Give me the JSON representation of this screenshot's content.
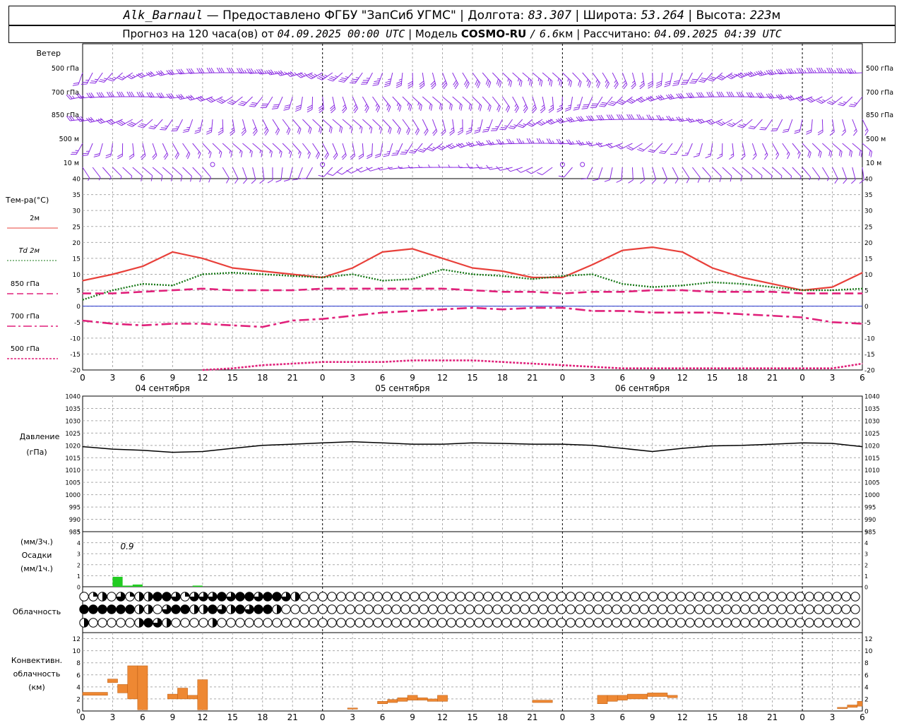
{
  "header": {
    "station": "Alk_Barnaul",
    "dash": "—",
    "provider": "Предоставлено ФГБУ \"ЗапСиб УГМС\"",
    "sep": "|",
    "lon_label": "Долгота:",
    "lon_value": "83.307",
    "lat_label": "Широта:",
    "lat_value": "53.264",
    "alt_label": "Высота:",
    "alt_value": "223",
    "alt_unit": "м",
    "forecast_text": "Прогноз на 120 часа(ов) от",
    "forecast_start": "04.09.2025 00:00 UTC",
    "model_label": "Модель",
    "model_name": "COSMO-RU",
    "model_res_sep": "/",
    "model_res": "6.6",
    "model_res_unit": "км",
    "calc_label": "Рассчитано:",
    "calc_time": "04.09.2025 04:39 UTC"
  },
  "colors": {
    "wind": "#8a2be2",
    "t2m": "#e8403a",
    "td2m": "#1a7a1a",
    "t850": "#e0207a",
    "t700": "#e0207a",
    "t500": "#e0207a",
    "pressure": "#000000",
    "precip": "#22cc22",
    "convective": "#ee8833",
    "zero_line": "#2233cc"
  },
  "wind_panel": {
    "title": "Ветер",
    "levels": [
      "500 гПа",
      "700 гПа",
      "850 гПа",
      "500 м",
      "10  м"
    ]
  },
  "temp_panel": {
    "title": "Тем-ра(°C)",
    "legend": [
      {
        "label": "2м",
        "style": "solid"
      },
      {
        "label": "Td  2м",
        "style": "dotted"
      },
      {
        "label": "850 гПа",
        "style": "dashed"
      },
      {
        "label": "700 гПа",
        "style": "dashdot"
      },
      {
        "label": "500 гПа",
        "style": "finedash"
      }
    ],
    "yticks": [
      "40",
      "35",
      "30",
      "25",
      "20",
      "15",
      "10",
      "5",
      "0",
      "-5",
      "-10",
      "-15",
      "-20"
    ]
  },
  "time_axis": {
    "hour_labels": [
      "0",
      "3",
      "6",
      "9",
      "12",
      "15",
      "18",
      "21",
      "0",
      "3",
      "6",
      "9",
      "12",
      "15",
      "18",
      "21",
      "0",
      "3",
      "6",
      "9",
      "12",
      "15",
      "18",
      "21",
      "0",
      "3",
      "6"
    ],
    "dates": [
      "04 сентября",
      "05 сентября",
      "06 сентября"
    ]
  },
  "pressure_panel": {
    "title": "Давление",
    "unit": "(гПа)",
    "yticks": [
      "1040",
      "1035",
      "1030",
      "1025",
      "1020",
      "1015",
      "1010",
      "1005",
      "1000",
      "995",
      "990",
      "985"
    ]
  },
  "precip_panel": {
    "unit_top": "(мм/3ч.)",
    "title": "Осадки",
    "unit_bottom": "(мм/1ч.)",
    "annotation": "0.9",
    "yticks": [
      "5",
      "4",
      "3",
      "2",
      "1",
      "0"
    ]
  },
  "cloud_panel": {
    "title": "Облачность",
    "rows": [
      "0120312244313334344344320000000000000000000000000000000000000000000000000000000000000000000000000000000000",
      "4444442203442243243442000000000000000000000000000000000000000000000000000000000000000000000000000000000000",
      "2000002432000020000000000000000000000000000000000000000000000000000000000000000000000000000000000000000000"
    ]
  },
  "conv_panel": {
    "title_1": "Конвективн.",
    "title_2": "облачность",
    "unit": "(км)",
    "yticks": [
      "12",
      "10",
      "8",
      "6",
      "4",
      "2",
      "0"
    ]
  },
  "chart_data": [
    {
      "type": "line",
      "title": "Тем-ра(°C)",
      "x_hours": [
        0,
        3,
        6,
        9,
        12,
        15,
        18,
        21,
        24,
        27,
        30,
        33,
        36,
        39,
        42,
        45,
        48,
        51,
        54,
        57,
        60,
        63,
        66,
        69,
        72,
        75,
        78
      ],
      "ylim": [
        -20,
        40
      ],
      "series": [
        {
          "name": "2м",
          "values": [
            8,
            10,
            12.5,
            17,
            15,
            12,
            11,
            10,
            9,
            12,
            17,
            18,
            15,
            12,
            11,
            9,
            9,
            13,
            17.5,
            18.5,
            17,
            12,
            9,
            7,
            5,
            6,
            10.5
          ]
        },
        {
          "name": "Td  2м",
          "values": [
            2,
            5,
            7,
            6.5,
            10,
            10.5,
            10,
            9.5,
            9,
            10,
            8,
            8.5,
            11.5,
            10,
            9.5,
            8.5,
            9.5,
            10,
            7,
            6,
            6.5,
            7.5,
            7,
            6,
            5,
            5,
            5.5
          ]
        },
        {
          "name": "850 гПа",
          "values": [
            4,
            4,
            4.5,
            5,
            5.5,
            5,
            5,
            5,
            5.5,
            5.5,
            5.5,
            5.5,
            5.5,
            5,
            4.5,
            4.5,
            4,
            4.5,
            4.5,
            5,
            5,
            4.5,
            4.5,
            4.5,
            4,
            4,
            4
          ]
        },
        {
          "name": "700 гПа",
          "values": [
            -4.5,
            -5.5,
            -6,
            -5.5,
            -5.5,
            -6,
            -6.5,
            -4.5,
            -4,
            -3,
            -2,
            -1.5,
            -1,
            -0.5,
            -1,
            -0.5,
            -0.5,
            -1.5,
            -1.5,
            -2,
            -2,
            -2,
            -2.5,
            -3,
            -3.5,
            -5,
            -5.5
          ]
        },
        {
          "name": "500 гПа",
          "values": [
            null,
            null,
            null,
            null,
            -20,
            -19.5,
            -18.5,
            -18,
            -17.5,
            -17.5,
            -17.5,
            -17,
            -17,
            -17,
            -17.5,
            -18,
            -18.5,
            -19,
            -19.5,
            -19.5,
            -19.5,
            -19.5,
            -19.5,
            -19.5,
            -19.5,
            -19.5,
            -18
          ]
        }
      ]
    },
    {
      "type": "line",
      "title": "Давление",
      "x_hours": [
        0,
        3,
        6,
        9,
        12,
        15,
        18,
        21,
        24,
        27,
        30,
        33,
        36,
        39,
        42,
        45,
        48,
        51,
        54,
        57,
        60,
        63,
        66,
        69,
        72,
        75,
        78
      ],
      "ylim": [
        985,
        1040
      ],
      "series": [
        {
          "name": "Давление",
          "values": [
            1019.5,
            1018.5,
            1018,
            1017.2,
            1017.5,
            1018.8,
            1020,
            1020.5,
            1021,
            1021.5,
            1021,
            1020.5,
            1020.5,
            1021,
            1020.8,
            1020.5,
            1020.5,
            1020,
            1018.8,
            1017.5,
            1018.8,
            1019.8,
            1020,
            1020.5,
            1021,
            1020.8,
            1019.5
          ]
        }
      ]
    },
    {
      "type": "bar",
      "title": "Осадки",
      "x_hours": [
        3.5,
        4.5,
        5.5,
        11.5
      ],
      "values": [
        0.9,
        0.1,
        0.2,
        0.1
      ],
      "ylim": [
        0,
        5
      ]
    },
    {
      "type": "bar",
      "title": "Конвективная облачность",
      "ylim": [
        0,
        13
      ],
      "segments": [
        {
          "from": 0,
          "to": 2.5,
          "bottom": 2.6,
          "top": 3.1
        },
        {
          "from": 2.5,
          "to": 3.5,
          "bottom": 4.7,
          "top": 5.3
        },
        {
          "from": 3.5,
          "to": 4.5,
          "bottom": 3.0,
          "top": 4.4
        },
        {
          "from": 4.5,
          "to": 5.5,
          "bottom": 2.0,
          "top": 7.5
        },
        {
          "from": 5.5,
          "to": 6.5,
          "bottom": 0.2,
          "top": 7.5
        },
        {
          "from": 8.5,
          "to": 9.5,
          "bottom": 2.0,
          "top": 2.8
        },
        {
          "from": 9.5,
          "to": 10.5,
          "bottom": 2.0,
          "top": 3.8
        },
        {
          "from": 10.5,
          "to": 11.5,
          "bottom": 2.0,
          "top": 2.6
        },
        {
          "from": 11.5,
          "to": 12.5,
          "bottom": 0.2,
          "top": 5.2
        },
        {
          "from": 26.5,
          "to": 27.5,
          "bottom": 0.3,
          "top": 0.5
        },
        {
          "from": 29.5,
          "to": 30.5,
          "bottom": 1.2,
          "top": 1.6
        },
        {
          "from": 30.5,
          "to": 31.5,
          "bottom": 1.4,
          "top": 1.9
        },
        {
          "from": 31.5,
          "to": 32.5,
          "bottom": 1.6,
          "top": 2.2
        },
        {
          "from": 32.5,
          "to": 33.5,
          "bottom": 1.8,
          "top": 2.6
        },
        {
          "from": 33.5,
          "to": 34.5,
          "bottom": 1.8,
          "top": 2.2
        },
        {
          "from": 34.5,
          "to": 35.5,
          "bottom": 1.6,
          "top": 2.0
        },
        {
          "from": 35.5,
          "to": 36.5,
          "bottom": 1.6,
          "top": 2.6
        },
        {
          "from": 45.0,
          "to": 47.0,
          "bottom": 1.4,
          "top": 1.8
        },
        {
          "from": 51.5,
          "to": 52.5,
          "bottom": 1.2,
          "top": 2.6
        },
        {
          "from": 52.5,
          "to": 53.5,
          "bottom": 1.6,
          "top": 2.6
        },
        {
          "from": 53.5,
          "to": 54.5,
          "bottom": 1.8,
          "top": 2.6
        },
        {
          "from": 54.5,
          "to": 56.5,
          "bottom": 2.0,
          "top": 2.8
        },
        {
          "from": 56.5,
          "to": 58.5,
          "bottom": 2.4,
          "top": 3.0
        },
        {
          "from": 58.5,
          "to": 59.5,
          "bottom": 2.2,
          "top": 2.6
        },
        {
          "from": 75.5,
          "to": 76.5,
          "bottom": 0.4,
          "top": 0.6
        },
        {
          "from": 76.5,
          "to": 77.5,
          "bottom": 0.6,
          "top": 1.0
        },
        {
          "from": 77.5,
          "to": 78,
          "bottom": 0.8,
          "top": 1.6
        }
      ]
    }
  ]
}
